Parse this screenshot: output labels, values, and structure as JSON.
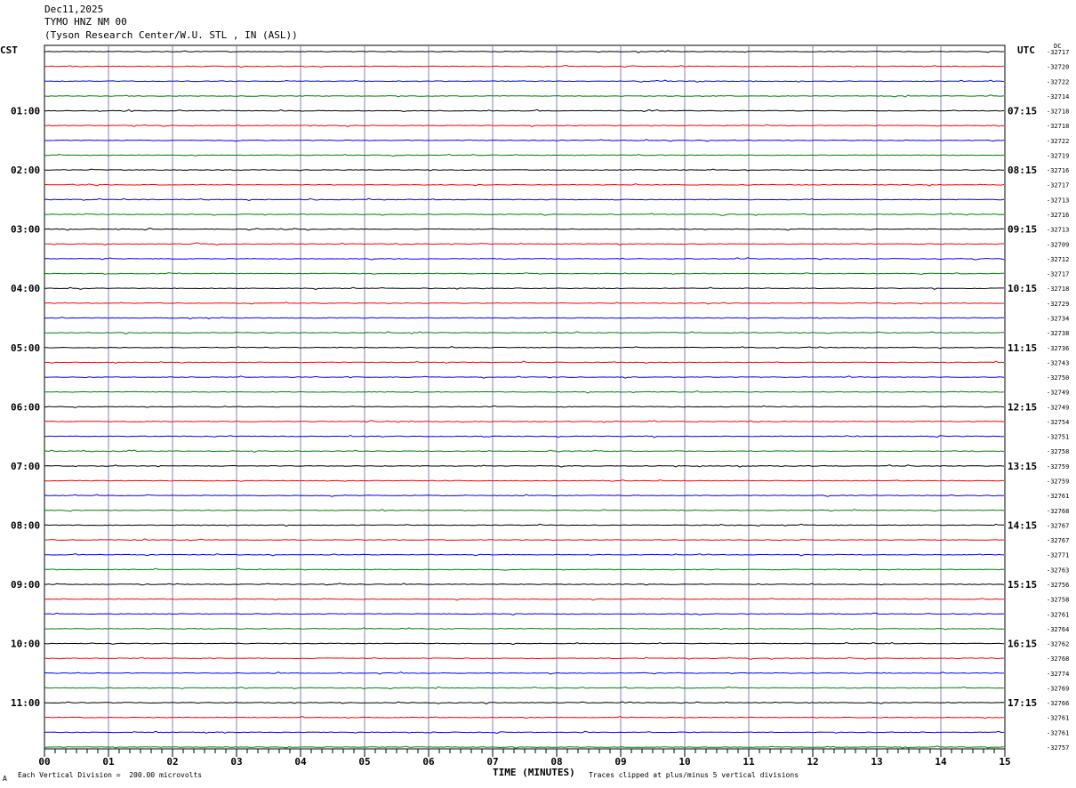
{
  "header": {
    "date": "Dec11,2025",
    "station": "TYMO HNZ NM 00",
    "location": "(Tyson Research Center/W.U. STL , IN (ASL))"
  },
  "labels": {
    "left_tz": "CST",
    "right_tz": "UTC",
    "dc": "DC"
  },
  "footer": {
    "scale": "Each Vertical Division =  200.00 microvolts",
    "clip": "Traces clipped at plus/minus 5 vertical divisions",
    "mark": "A"
  },
  "chart_data": {
    "type": "line",
    "title": "",
    "xlabel": "TIME (MINUTES)",
    "ylabel": "",
    "x_ticks": [
      "00",
      "01",
      "02",
      "03",
      "04",
      "05",
      "06",
      "07",
      "08",
      "09",
      "10",
      "11",
      "12",
      "13",
      "14",
      "15"
    ],
    "xlim": [
      0,
      15
    ],
    "grid": true,
    "trace_colors": [
      "#000000",
      "#ff0000",
      "#0000ff",
      "#008000"
    ],
    "hour_labels_left": [
      "01:00",
      "02:00",
      "03:00",
      "04:00",
      "05:00",
      "06:00",
      "07:00",
      "08:00",
      "09:00",
      "10:00",
      "11:00"
    ],
    "hour_labels_right": [
      "07:15",
      "08:15",
      "09:15",
      "10:15",
      "11:15",
      "12:15",
      "13:15",
      "14:15",
      "15:15",
      "16:15",
      "17:15"
    ],
    "dc_offsets": [
      -32717,
      -32720,
      -32722,
      -32714,
      -32718,
      -32718,
      -32722,
      -32719,
      -32716,
      -32717,
      -32713,
      -32716,
      -32713,
      -32709,
      -32712,
      -32717,
      -32718,
      -32729,
      -32734,
      -32738,
      -32736,
      -32743,
      -32750,
      -32749,
      -32749,
      -32754,
      -32751,
      -32758,
      -32759,
      -32759,
      -32761,
      -32768,
      -32767,
      -32767,
      -32771,
      -32763,
      -32756,
      -32758,
      -32761,
      -32764,
      -32762,
      -32768,
      -32774,
      -32769,
      -32766,
      -32761,
      -32761,
      -32757
    ],
    "series": [
      {
        "name": "",
        "values": []
      }
    ]
  }
}
